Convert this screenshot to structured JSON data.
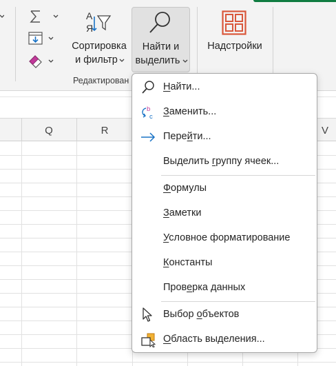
{
  "ribbon": {
    "sort_filter": {
      "line1": "Сортировка",
      "line2": "и фильтр"
    },
    "find_select": {
      "line1": "Найти и",
      "line2": "выделить"
    },
    "addins": {
      "label": "Надстройки"
    },
    "group_label": "Редактирован",
    "sort_icon_letters": {
      "top": "А",
      "bottom": "Я"
    }
  },
  "columns": [
    "Q",
    "R",
    "V"
  ],
  "menu": {
    "items": [
      {
        "pre": "",
        "key": "Н",
        "post": "айти..."
      },
      {
        "pre": "",
        "key": "З",
        "post": "аменить..."
      },
      {
        "pre": "Пере",
        "key": "й",
        "post": "ти..."
      },
      {
        "pre": "Выделить ",
        "key": "г",
        "post": "руппу ячеек..."
      },
      {
        "pre": "",
        "key": "Ф",
        "post": "ормулы"
      },
      {
        "pre": "",
        "key": "З",
        "post": "аметки"
      },
      {
        "pre": "",
        "key": "У",
        "post": "словное форматирование"
      },
      {
        "pre": "",
        "key": "К",
        "post": "онстанты"
      },
      {
        "pre": "Пров",
        "key": "е",
        "post": "рка данных"
      },
      {
        "pre": "Выбор ",
        "key": "о",
        "post": "бъектов"
      },
      {
        "pre": "",
        "key": "О",
        "post": "бласть выделения..."
      }
    ],
    "replace_icon_letters": {
      "b": "b",
      "c": "c"
    }
  },
  "colors": {
    "accent_orange": "#d9573b",
    "accent_blue": "#1a73c6",
    "eraser_pink": "#c2399a",
    "excel_green": "#107c41"
  }
}
